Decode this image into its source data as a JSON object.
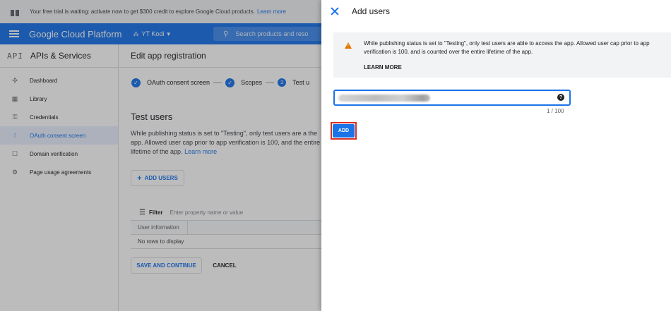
{
  "trial_banner": {
    "text": "Your free trial is waiting: activate now to get $300 credit to explore Google Cloud products.",
    "link": "Learn more"
  },
  "topbar": {
    "brand": "Google Cloud Platform",
    "project": "YT Kodi",
    "search_placeholder": "Search products and reso"
  },
  "sidebar": {
    "logo": "API",
    "title": "APIs & Services",
    "items": [
      {
        "label": "Dashboard",
        "icon": "dashboard-icon"
      },
      {
        "label": "Library",
        "icon": "library-icon"
      },
      {
        "label": "Credentials",
        "icon": "key-icon"
      },
      {
        "label": "OAuth consent screen",
        "icon": "consent-icon"
      },
      {
        "label": "Domain verification",
        "icon": "domain-icon"
      },
      {
        "label": "Page usage agreements",
        "icon": "settings-list-icon"
      }
    ]
  },
  "main": {
    "title": "Edit app registration",
    "steps": [
      {
        "label": "OAuth consent screen",
        "state": "done"
      },
      {
        "label": "Scopes",
        "state": "done"
      },
      {
        "label": "Test u",
        "state": "current",
        "number": "3"
      }
    ],
    "section_title": "Test users",
    "description": "While publishing status is set to \"Testing\", only test users are a the app. Allowed user cap prior to app verification is 100, and the entire lifetime of the app.",
    "description_link": "Learn more",
    "add_users_label": "ADD USERS",
    "filter_label": "Filter",
    "filter_placeholder": "Enter property name or value",
    "table_header": "User information",
    "table_empty": "No rows to display",
    "save_label": "SAVE AND CONTINUE",
    "cancel_label": "CANCEL"
  },
  "panel": {
    "title": "Add users",
    "warning_text": "While publishing status is set to \"Testing\", only test users are able to access the app. Allowed user cap prior to app verification is 100, and is counted over the entire lifetime of the app.",
    "learn_more": "LEARN MORE",
    "input_value": "",
    "counter": "1 / 100",
    "add_label": "ADD"
  },
  "colors": {
    "accent": "#1a73e8",
    "warning": "#e37400",
    "highlight": "#d93025"
  }
}
